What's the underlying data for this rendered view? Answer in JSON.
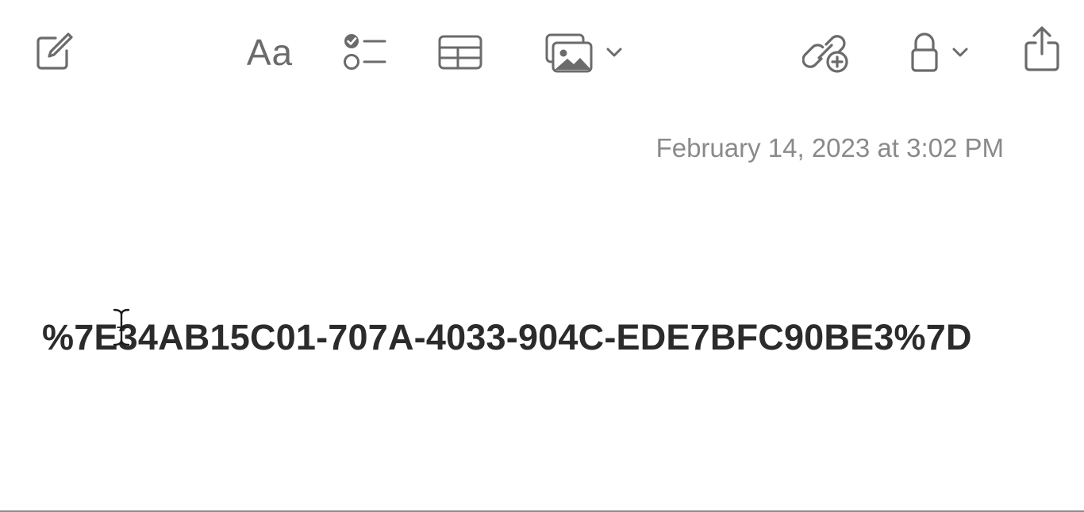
{
  "toolbar": {
    "compose_icon": "compose-icon",
    "format_label": "Aa",
    "checklist_icon": "checklist-icon",
    "table_icon": "table-icon",
    "media_icon": "photo-stack-icon",
    "collaborate_icon": "link-add-icon",
    "lock_icon": "lock-icon",
    "share_icon": "share-icon"
  },
  "note": {
    "date": "February 14, 2023 at 3:02 PM",
    "body": "%7E34AB15C01-707A-4033-904C-EDE7BFC90BE3%7D"
  },
  "colors": {
    "icon": "#6b6b6b",
    "date": "#8a8a8a",
    "body_text": "#2b2b2b",
    "background": "#ffffff"
  }
}
